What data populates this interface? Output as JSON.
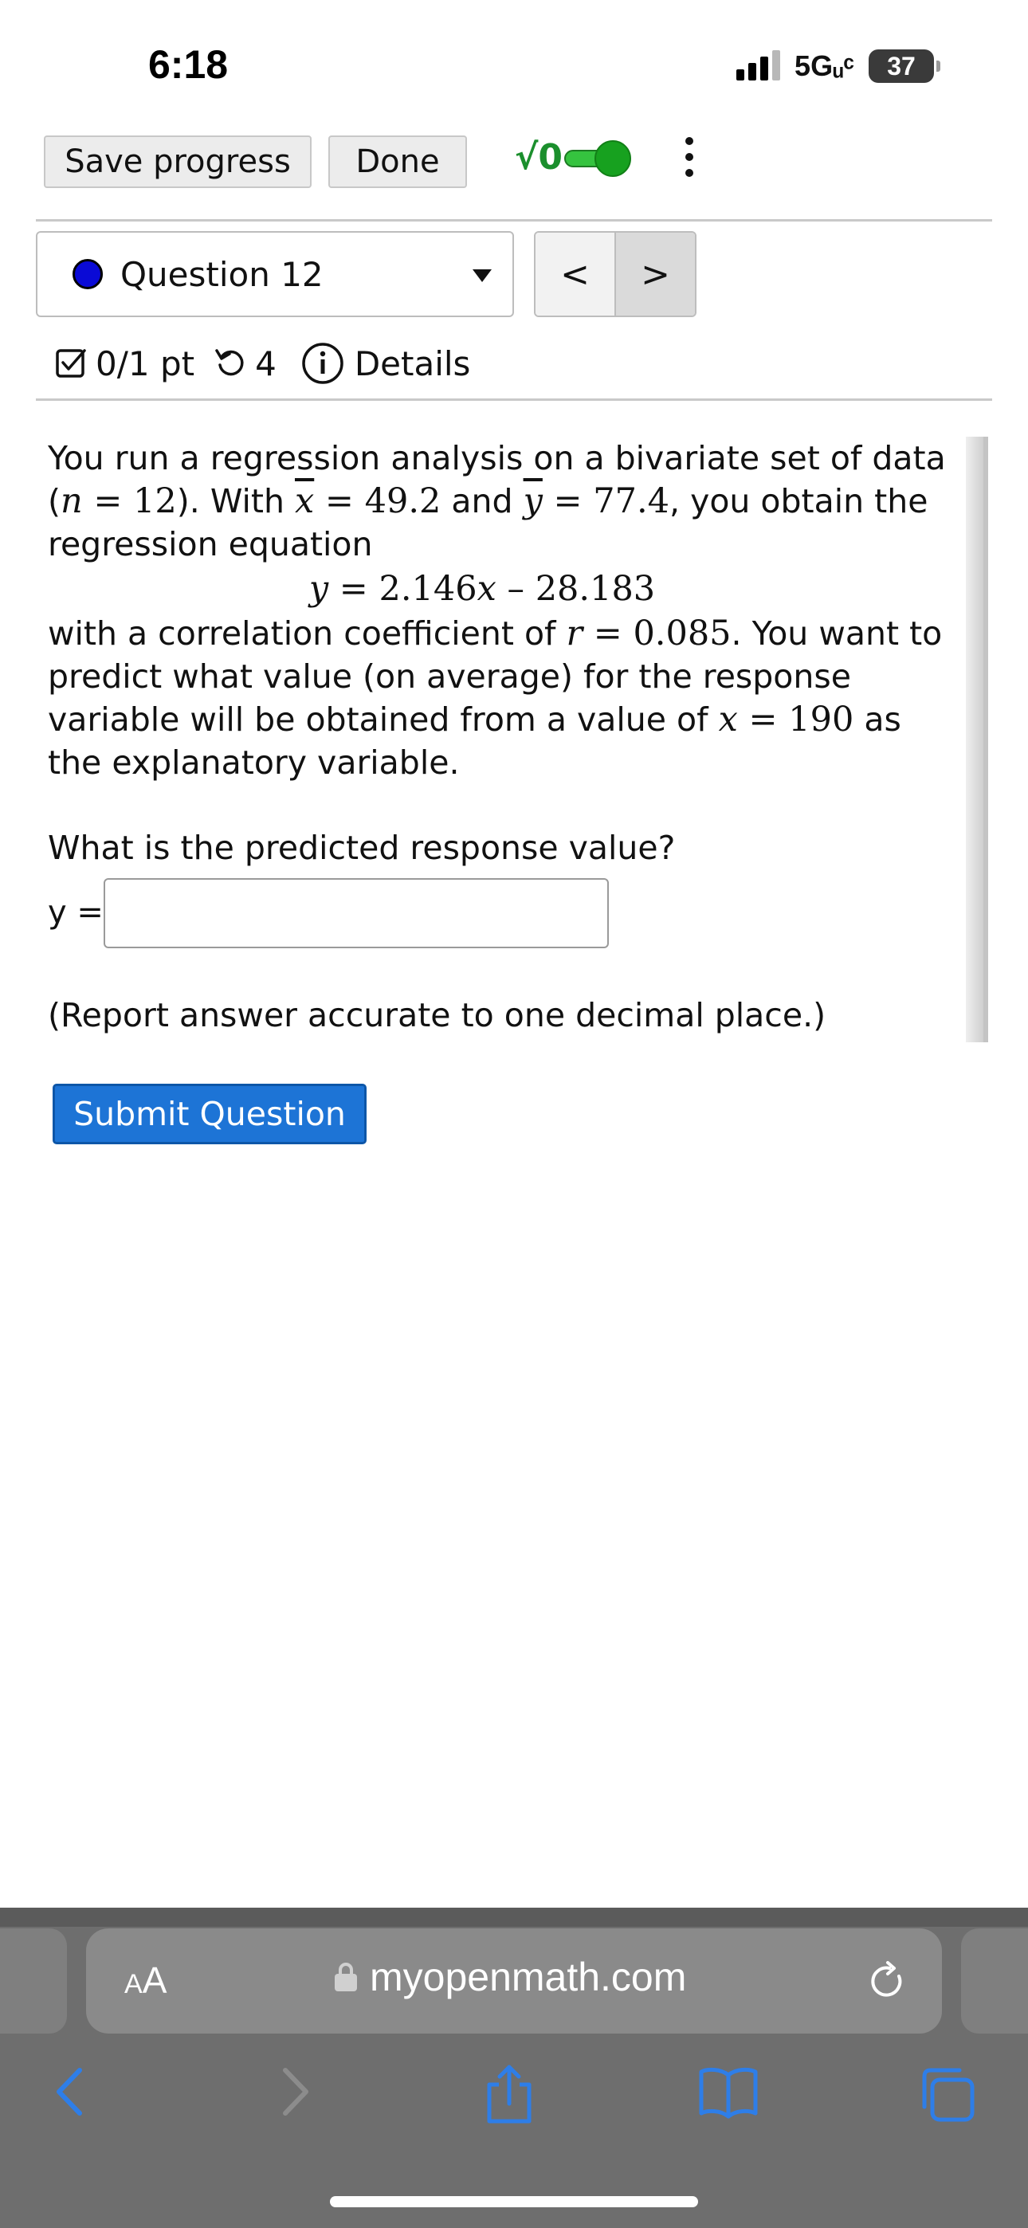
{
  "status_bar": {
    "time": "6:18",
    "network": "5Gᵤᶜ",
    "battery": "37"
  },
  "toolbar": {
    "save_label": "Save progress",
    "done_label": "Done",
    "sqrt_label": "√0",
    "sqrt_toggle_on": true
  },
  "question_nav": {
    "selected": "Question 12",
    "prev": "<",
    "next": ">"
  },
  "info": {
    "points": "0/1 pt",
    "attempts": "4",
    "details": "Details"
  },
  "question": {
    "t1": "You run a regression analysis on a bivariate set of data (",
    "n_var": "n",
    "eq": " = ",
    "n_val": "12",
    "t2": "). With ",
    "xbar": "x",
    "xbar_val": "49.2",
    "t3": " and ",
    "ybar": "y",
    "ybar_val": "77.4",
    "t4": ", you obtain the regression equation",
    "reg_y": "y",
    "reg_rhs": " = 2.146",
    "reg_x": "x",
    "reg_tail": " – 28.183",
    "t5": "with a correlation coefficient of ",
    "r_var": "r",
    "r_val": "0.085",
    "t6": ". You want to predict what value (on average) for the response variable will be obtained from a value of ",
    "x_var": "x",
    "x_val": "190",
    "t7": " as the explanatory variable.",
    "prompt": "What is the predicted response value?",
    "y_label": "y =",
    "answer_value": "",
    "report_note": "(Report answer accurate to one decimal place.)",
    "submit_label": "Submit Question"
  },
  "browser": {
    "aa_big": "A",
    "aa_small": "A",
    "url": "myopenmath.com"
  }
}
